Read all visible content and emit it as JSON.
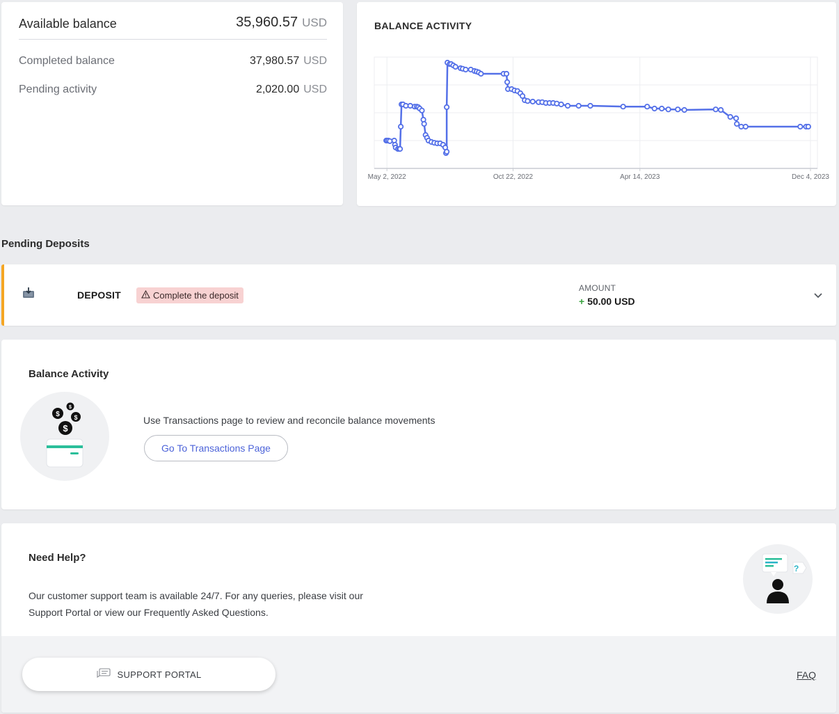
{
  "balance": {
    "available_label": "Available balance",
    "available_value": "35,960.57",
    "available_currency": "USD",
    "completed_label": "Completed balance",
    "completed_value": "37,980.57",
    "completed_currency": "USD",
    "pending_label": "Pending activity",
    "pending_value": "2,020.00",
    "pending_currency": "USD"
  },
  "chart_card": {
    "title": "BALANCE ACTIVITY"
  },
  "chart_data": {
    "type": "line",
    "title": "BALANCE ACTIVITY",
    "xlabel": "",
    "ylabel": "",
    "x_ticks": [
      "May 2, 2022",
      "Oct 22, 2022",
      "Apr 14, 2023",
      "Dec 4, 2023"
    ],
    "y_tick_labels_shown": false,
    "grid": true,
    "line_color": "#5470e8",
    "x_domain": [
      "2022-04-28",
      "2023-12-04"
    ],
    "y_domain_relative": [
      0,
      4
    ],
    "series": [
      {
        "points": [
          [
            "2022-05-01",
            1.0
          ],
          [
            "2022-05-02",
            1.0
          ],
          [
            "2022-05-04",
            1.0
          ],
          [
            "2022-05-06",
            0.98
          ],
          [
            "2022-05-12",
            1.0
          ],
          [
            "2022-05-13",
            0.85
          ],
          [
            "2022-05-14",
            0.75
          ],
          [
            "2022-05-17",
            0.7
          ],
          [
            "2022-05-19",
            0.7
          ],
          [
            "2022-05-20",
            0.7
          ],
          [
            "2022-05-21",
            1.5
          ],
          [
            "2022-05-22",
            2.3
          ],
          [
            "2022-05-24",
            2.3
          ],
          [
            "2022-05-28",
            2.25
          ],
          [
            "2022-06-03",
            2.25
          ],
          [
            "2022-06-09",
            2.22
          ],
          [
            "2022-06-12",
            2.22
          ],
          [
            "2022-06-14",
            2.2
          ],
          [
            "2022-06-16",
            2.15
          ],
          [
            "2022-06-19",
            2.08
          ],
          [
            "2022-06-21",
            1.75
          ],
          [
            "2022-06-22",
            1.6
          ],
          [
            "2022-06-24",
            1.2
          ],
          [
            "2022-06-26",
            1.1
          ],
          [
            "2022-06-28",
            1.0
          ],
          [
            "2022-07-02",
            0.95
          ],
          [
            "2022-07-06",
            0.92
          ],
          [
            "2022-07-10",
            0.9
          ],
          [
            "2022-07-14",
            0.9
          ],
          [
            "2022-07-18",
            0.85
          ],
          [
            "2022-07-21",
            0.75
          ],
          [
            "2022-07-22",
            0.55
          ],
          [
            "2022-07-23",
            0.6
          ],
          [
            "2022-07-23",
            2.2
          ],
          [
            "2022-07-24",
            3.8
          ],
          [
            "2022-07-27",
            3.75
          ],
          [
            "2022-07-29",
            3.75
          ],
          [
            "2022-08-01",
            3.7
          ],
          [
            "2022-08-04",
            3.65
          ],
          [
            "2022-08-11",
            3.6
          ],
          [
            "2022-08-14",
            3.58
          ],
          [
            "2022-08-18",
            3.55
          ],
          [
            "2022-08-25",
            3.55
          ],
          [
            "2022-08-30",
            3.5
          ],
          [
            "2022-09-02",
            3.48
          ],
          [
            "2022-09-05",
            3.45
          ],
          [
            "2022-09-08",
            3.4
          ],
          [
            "2022-10-09",
            3.4
          ],
          [
            "2022-10-13",
            3.4
          ],
          [
            "2022-10-14",
            3.1
          ],
          [
            "2022-10-15",
            2.85
          ],
          [
            "2022-10-20",
            2.85
          ],
          [
            "2022-10-24",
            2.8
          ],
          [
            "2022-10-28",
            2.78
          ],
          [
            "2022-11-01",
            2.7
          ],
          [
            "2022-11-04",
            2.6
          ],
          [
            "2022-11-07",
            2.45
          ],
          [
            "2022-11-11",
            2.42
          ],
          [
            "2022-11-18",
            2.4
          ],
          [
            "2022-11-26",
            2.38
          ],
          [
            "2022-12-01",
            2.38
          ],
          [
            "2022-12-06",
            2.35
          ],
          [
            "2022-12-11",
            2.35
          ],
          [
            "2022-12-16",
            2.35
          ],
          [
            "2022-12-21",
            2.33
          ],
          [
            "2022-12-27",
            2.3
          ],
          [
            "2023-01-05",
            2.25
          ],
          [
            "2023-01-20",
            2.25
          ],
          [
            "2023-02-05",
            2.25
          ],
          [
            "2023-03-22",
            2.22
          ],
          [
            "2023-04-24",
            2.22
          ],
          [
            "2023-05-04",
            2.15
          ],
          [
            "2023-05-14",
            2.15
          ],
          [
            "2023-05-23",
            2.12
          ],
          [
            "2023-06-05",
            2.12
          ],
          [
            "2023-06-14",
            2.1
          ],
          [
            "2023-07-27",
            2.12
          ],
          [
            "2023-08-03",
            2.1
          ],
          [
            "2023-08-16",
            1.85
          ],
          [
            "2023-08-24",
            1.8
          ],
          [
            "2023-08-25",
            1.6
          ],
          [
            "2023-08-31",
            1.5
          ],
          [
            "2023-09-06",
            1.5
          ],
          [
            "2023-11-20",
            1.5
          ],
          [
            "2023-11-28",
            1.5
          ],
          [
            "2023-12-01",
            1.5
          ]
        ]
      }
    ]
  },
  "pending": {
    "section_title": "Pending Deposits",
    "deposit_label": "DEPOSIT",
    "badge_text": "Complete the deposit",
    "amount_label": "AMOUNT",
    "amount_sign": "+",
    "amount_value": "50.00 USD",
    "accent_color": "#f5a623"
  },
  "activity": {
    "title": "Balance Activity",
    "description": "Use Transactions page to review and reconcile balance movements",
    "button_label": "Go To Transactions Page"
  },
  "help": {
    "title": "Need Help?",
    "text_line1": "Our customer support team is available 24/7. For any queries, please visit our",
    "text_line2": "Support Portal or view our Frequently Asked Questions.",
    "support_button_label": "SUPPORT PORTAL",
    "faq_label": "FAQ"
  },
  "icons": {
    "deposit": "deposit-icon",
    "warning": "warning-icon",
    "expand": "chevron-down-icon",
    "chat": "chat-icon",
    "coins": "coins-icon",
    "support_person": "support-person-icon"
  }
}
